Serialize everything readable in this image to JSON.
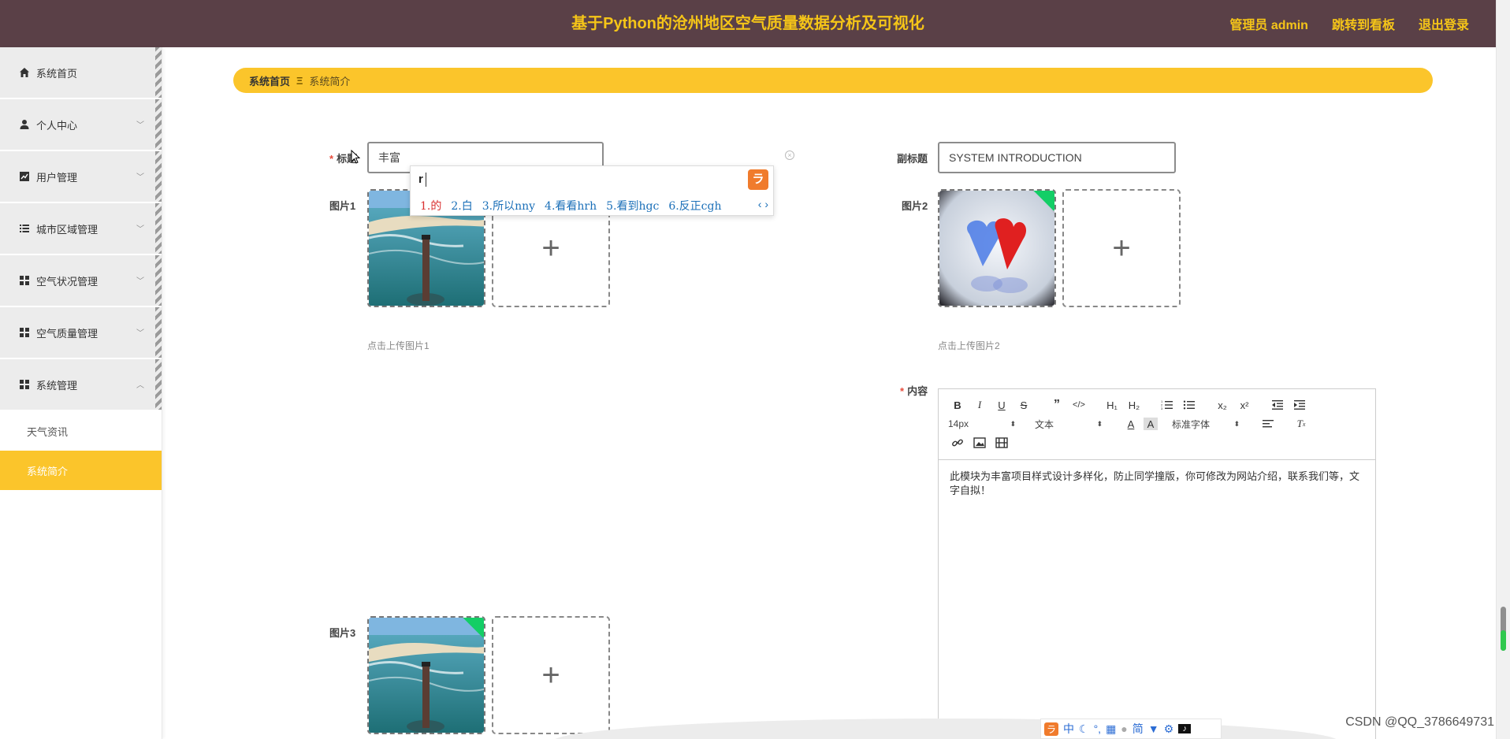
{
  "header": {
    "title": "基于Python的沧州地区空气质量数据分析及可视化",
    "nav": [
      "管理员 admin",
      "跳转到看板",
      "退出登录"
    ]
  },
  "sidebar": {
    "items": [
      {
        "label": "系统首页",
        "icon": "home-icon"
      },
      {
        "label": "个人中心",
        "icon": "user-icon"
      },
      {
        "label": "用户管理",
        "icon": "chart-icon"
      },
      {
        "label": "城市区域管理",
        "icon": "list-icon"
      },
      {
        "label": "空气状况管理",
        "icon": "grid-icon"
      },
      {
        "label": "空气质量管理",
        "icon": "grid-icon"
      },
      {
        "label": "系统管理",
        "icon": "grid-icon"
      }
    ],
    "subitems": [
      {
        "label": "天气资讯"
      },
      {
        "label": "系统简介"
      }
    ]
  },
  "breadcrumb": {
    "home": "系统首页",
    "separator": "Ξ",
    "current": "系统简介"
  },
  "form": {
    "title_label": "标题",
    "title_value": "丰富",
    "subtitle_label": "副标题",
    "subtitle_value": "SYSTEM INTRODUCTION",
    "pic1_label": "图片1",
    "pic1_hint": "点击上传图片1",
    "pic2_label": "图片2",
    "pic2_hint": "点击上传图片2",
    "pic3_label": "图片3",
    "content_label": "内容"
  },
  "ime": {
    "typed": "r",
    "candidates": [
      "1.的",
      "2.白",
      "3.所以nny",
      "4.看看hrh",
      "5.看到hgc",
      "6.反正cgh"
    ]
  },
  "editor": {
    "font_size": "14px",
    "header_select": "文本",
    "font_family": "标准字体",
    "content": "此模块为丰富项目样式设计多样化，防止同学撞版，你可修改为网站介绍，联系我们等，文字自拟！"
  },
  "taskbar": {
    "ime_chars": [
      "中",
      "简"
    ]
  },
  "watermark": "CSDN @QQ_3786649731"
}
